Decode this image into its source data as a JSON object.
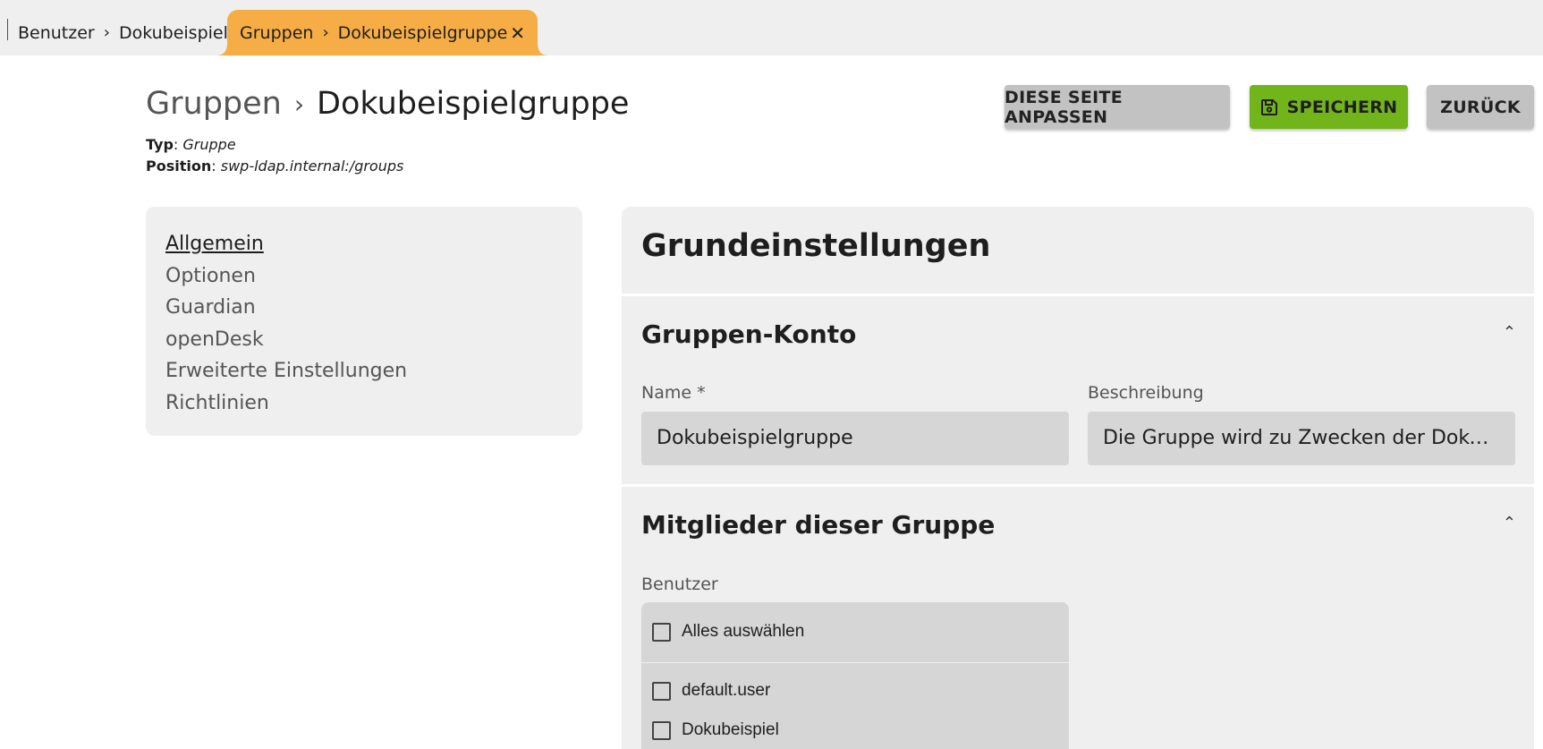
{
  "tabs": [
    {
      "parts": [
        "Benutzer",
        "Dokubeispiel"
      ]
    },
    {
      "parts": [
        "Gruppen",
        "Dokubeispielgruppe"
      ]
    }
  ],
  "header": {
    "breadcrumb": [
      "Gruppen",
      "Dokubeispielgruppe"
    ],
    "type_label": "Typ",
    "type_value": "Gruppe",
    "position_label": "Position",
    "position_value": "swp-ldap.internal:/groups"
  },
  "buttons": {
    "customize": "DIESE SEITE ANPASSEN",
    "save": "SPEICHERN",
    "back": "ZURÜCK"
  },
  "colors": {
    "active_tab": "#f6ad45",
    "save_button": "#72b51b",
    "panel_bg": "#efefef",
    "input_bg": "#d6d6d6"
  },
  "sidenav": {
    "items": [
      "Allgemein",
      "Optionen",
      "Guardian",
      "openDesk",
      "Erweiterte Einstellungen",
      "Richtlinien"
    ],
    "active": "Allgemein"
  },
  "main": {
    "title": "Grundeinstellungen",
    "sections": [
      {
        "title": "Gruppen-Konto",
        "fields": {
          "name_label": "Name *",
          "name_value": "Dokubeispielgruppe",
          "description_label": "Beschreibung",
          "description_value": "Die Gruppe wird zu Zwecken der Dokumentation angelegt"
        }
      },
      {
        "title": "Mitglieder dieser Gruppe",
        "users_label": "Benutzer",
        "select_all": "Alles auswählen",
        "users": [
          "default.user",
          "Dokubeispiel"
        ]
      }
    ]
  },
  "icons": {
    "tab_chevron": "chevron-right-icon",
    "tab_close": "close-icon",
    "save": "floppy-disk-icon",
    "collapse": "chevron-up-icon"
  }
}
